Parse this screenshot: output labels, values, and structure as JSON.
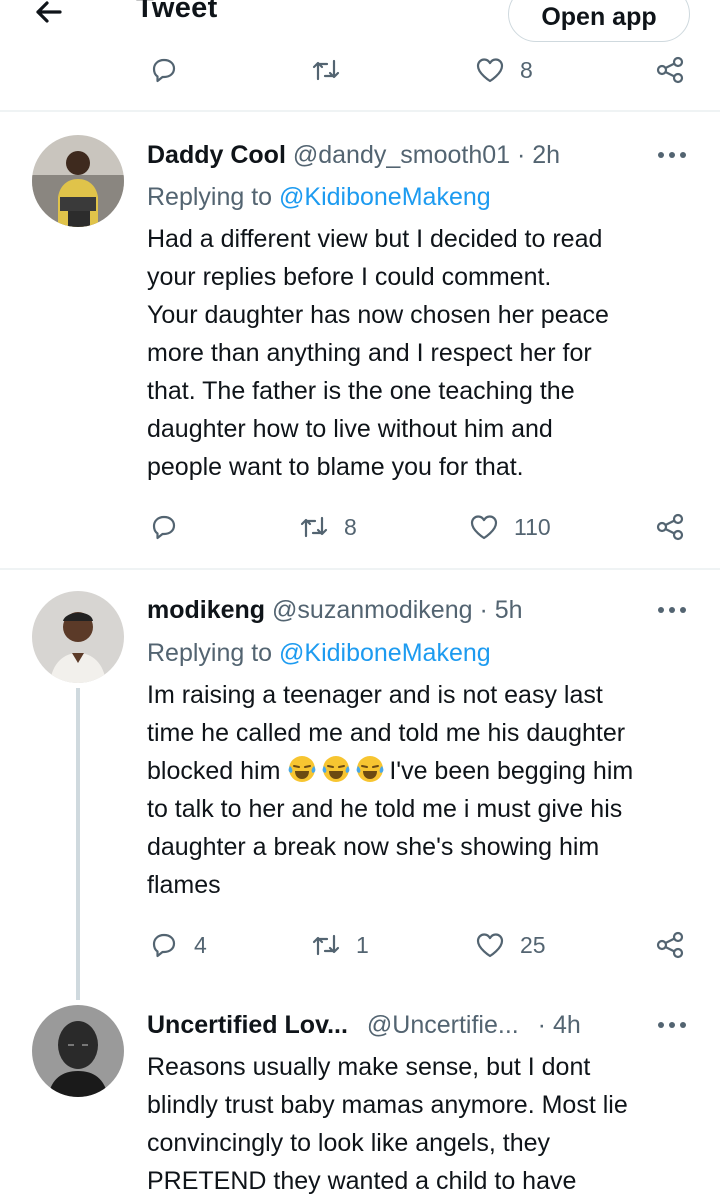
{
  "header": {
    "back_icon": "arrow-left-icon",
    "title": "Tweet",
    "open_app_label": "Open app"
  },
  "previous_tweet": {
    "likes": "8"
  },
  "replies": [
    {
      "name": "Daddy Cool",
      "handle": "@dandy_smooth01",
      "separator": "·",
      "time": "2h",
      "replying_prefix": "Replying to",
      "replying_to": "@KidiboneMakeng",
      "text_lines": [
        "Had a different view but I decided to read",
        "your replies before I could comment.",
        "Your daughter has now chosen her peace",
        "more than anything and I respect her for",
        "that. The father is the one teaching the",
        "daughter how to live without him and",
        "people want to blame you for that."
      ],
      "reply_count": "",
      "retweet_count": "8",
      "like_count": "110"
    },
    {
      "name": "modikeng",
      "handle": "@suzanmodikeng",
      "separator": "·",
      "time": "5h",
      "replying_prefix": "Replying to",
      "replying_to": "@KidiboneMakeng",
      "text_lines": [
        "Im raising a teenager and is not easy last",
        "time he called me and told me his daughter",
        "blocked him ",
        "I've been begging him",
        "to talk to her and he told me i must give his",
        "daughter a break now she's showing him",
        "flames"
      ],
      "emoji_name": "face-with-tears-of-joy",
      "reply_count": "4",
      "retweet_count": "1",
      "like_count": "25"
    },
    {
      "name": "Uncertified Lov...",
      "handle": "@Uncertifie...",
      "separator": "·",
      "time": "4h",
      "text_lines": [
        "Reasons usually make sense, but I dont",
        "blindly trust baby mamas anymore. Most lie",
        "convincingly to look like angels, they",
        "PRETEND they wanted a child to have"
      ]
    }
  ],
  "colors": {
    "text": "#0f1419",
    "muted": "#536471",
    "link": "#1d9bf0",
    "divider": "#eff3f4",
    "thread_line": "#cfd9de"
  }
}
